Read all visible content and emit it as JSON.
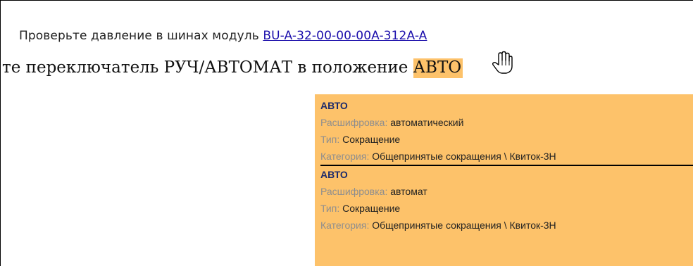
{
  "text": {
    "line1_prefix": "Проверьте давление в шинах модуль",
    "line1_link": "BU-A-32-00-00-00A-312A-A",
    "line2_prefix": "те переключатель РУЧ/АВТОМАТ в положение",
    "line2_highlight": "АВТО"
  },
  "tooltip": {
    "entries": [
      {
        "term": "АВТО",
        "decoding_label": "Расшифровка:",
        "decoding_value": "автоматический",
        "type_label": "Тип:",
        "type_value": "Сокращение",
        "category_label": "Категория:",
        "category_value": "Общепринятые сокращения \\ Квиток-3Н"
      },
      {
        "term": "АВТО",
        "decoding_label": "Расшифровка:",
        "decoding_value": "автомат",
        "type_label": "Тип:",
        "type_value": "Сокращение",
        "category_label": "Категория:",
        "category_value": "Общепринятые сокращения \\ Квиток-3Н"
      }
    ]
  },
  "colors": {
    "highlight": "#fdc26a",
    "link": "#1a0dab",
    "term": "#1c2a6b",
    "label": "#8e8e8e"
  },
  "icons": {
    "cursor": "hand-pointer-icon"
  }
}
